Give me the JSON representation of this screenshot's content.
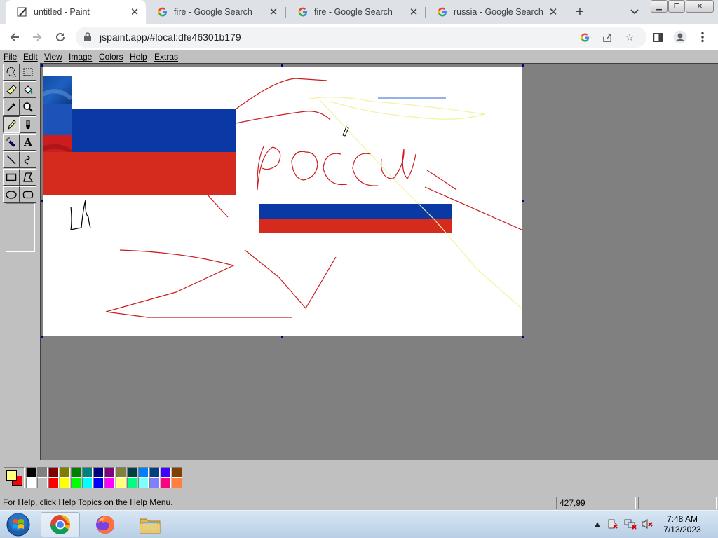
{
  "browser": {
    "tabs": [
      {
        "title": "untitled - Paint",
        "active": true
      },
      {
        "title": "fire - Google Search",
        "active": false
      },
      {
        "title": "fire - Google Search",
        "active": false
      },
      {
        "title": "russia - Google Search",
        "active": false
      }
    ],
    "url": "jspaint.app/#local:dfe46301b179"
  },
  "paint": {
    "menu": [
      "File",
      "Edit",
      "View",
      "Image",
      "Colors",
      "Help",
      "Extras"
    ],
    "tools": [
      "free-form-select",
      "select",
      "eraser",
      "fill-with-color",
      "pick-color",
      "magnifier",
      "pencil",
      "brush",
      "airbrush",
      "text",
      "line",
      "curve",
      "rectangle",
      "polygon",
      "ellipse",
      "rounded-rectangle"
    ],
    "selected_tool": "pencil",
    "canvas_text": "Россия",
    "status_help": "For Help, click Help Topics on the Help Menu.",
    "status_coords": "427,99",
    "primary_color": "#ffff80",
    "secondary_color": "#ff0000",
    "palette_top": [
      "#000000",
      "#808080",
      "#800000",
      "#808000",
      "#008000",
      "#008080",
      "#000080",
      "#800080",
      "#808040",
      "#004040",
      "#0080ff",
      "#004080",
      "#4000ff",
      "#804000"
    ],
    "palette_bottom": [
      "#ffffff",
      "#c0c0c0",
      "#ff0000",
      "#ffff00",
      "#00ff00",
      "#00ffff",
      "#0000ff",
      "#ff00ff",
      "#ffff80",
      "#00ff80",
      "#80ffff",
      "#8080ff",
      "#ff0080",
      "#ff8040"
    ]
  },
  "taskbar": {
    "time": "7:48 AM",
    "date": "7/13/2023"
  }
}
